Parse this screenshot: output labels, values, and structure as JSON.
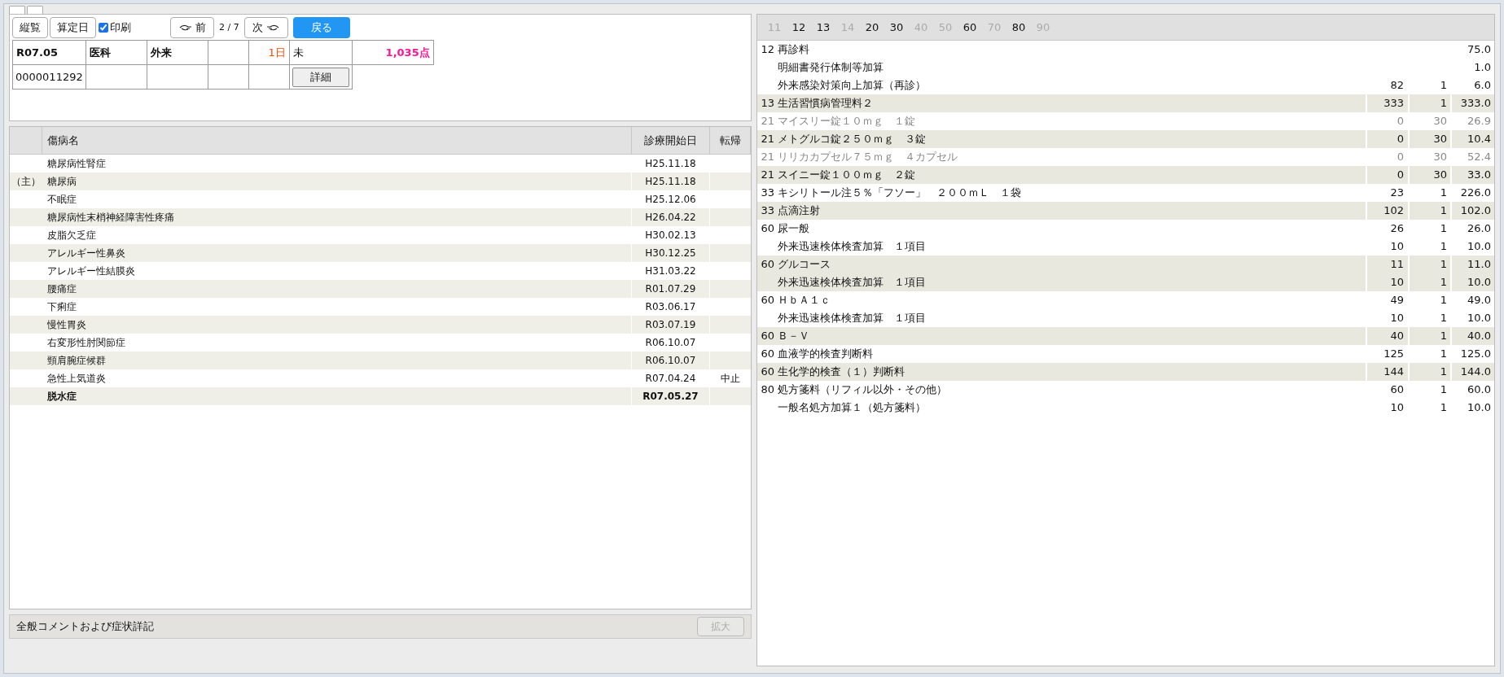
{
  "toolbar": {
    "buttons": [
      {
        "label": "縦覧"
      },
      {
        "label": "算定日"
      }
    ],
    "print_checkbox": {
      "label": "印刷",
      "checked": true
    },
    "prev_button": {
      "label": "前"
    },
    "page_indicator": "2 / 7",
    "next_button": {
      "label": "次"
    },
    "back_button": {
      "label": "戻る"
    }
  },
  "summary": {
    "row_1": {
      "column_1": "R07.05",
      "column_2": "医科",
      "column_3": "外来",
      "column_5": "1日",
      "column_6": "未",
      "column_7": "1,035点"
    },
    "row_2": {
      "column_1": "0000011292"
    },
    "detail_button": "詳細"
  },
  "disease_table": {
    "columns": [
      "",
      "傷病名",
      "診療開始日",
      "転帰"
    ],
    "rows": [
      {
        "prefix": "",
        "name": "糖尿病性腎症",
        "start": "H25.11.18",
        "outcome": "",
        "bold": false
      },
      {
        "prefix": "（主）",
        "name": "糖尿病",
        "start": "H25.11.18",
        "outcome": "",
        "bold": false
      },
      {
        "prefix": "",
        "name": "不眠症",
        "start": "H25.12.06",
        "outcome": "",
        "bold": false
      },
      {
        "prefix": "",
        "name": "糖尿病性末梢神経障害性疼痛",
        "start": "H26.04.22",
        "outcome": "",
        "bold": false
      },
      {
        "prefix": "",
        "name": "皮脂欠乏症",
        "start": "H30.02.13",
        "outcome": "",
        "bold": false
      },
      {
        "prefix": "",
        "name": "アレルギー性鼻炎",
        "start": "H30.12.25",
        "outcome": "",
        "bold": false
      },
      {
        "prefix": "",
        "name": "アレルギー性結膜炎",
        "start": "H31.03.22",
        "outcome": "",
        "bold": false
      },
      {
        "prefix": "",
        "name": "腰痛症",
        "start": "R01.07.29",
        "outcome": "",
        "bold": false
      },
      {
        "prefix": "",
        "name": "下痢症",
        "start": "R03.06.17",
        "outcome": "",
        "bold": false
      },
      {
        "prefix": "",
        "name": "慢性胃炎",
        "start": "R03.07.19",
        "outcome": "",
        "bold": false
      },
      {
        "prefix": "",
        "name": "右変形性肘関節症",
        "start": "R06.10.07",
        "outcome": "",
        "bold": false
      },
      {
        "prefix": "",
        "name": "頸肩腕症候群",
        "start": "R06.10.07",
        "outcome": "",
        "bold": false
      },
      {
        "prefix": "",
        "name": "急性上気道炎",
        "start": "R07.04.24",
        "outcome": "中止",
        "bold": false
      },
      {
        "prefix": "",
        "name": "脱水症",
        "start": "R07.05.27",
        "outcome": "",
        "bold": true
      }
    ]
  },
  "comment_bar": {
    "label": "全般コメントおよび症状詳記",
    "expand_button": {
      "label": "拡大",
      "disabled": true
    }
  },
  "category_tabs": [
    {
      "label": "11",
      "disabled": true
    },
    {
      "label": "12",
      "disabled": false
    },
    {
      "label": "13",
      "disabled": false
    },
    {
      "label": "14",
      "disabled": true
    },
    {
      "label": "20",
      "disabled": false
    },
    {
      "label": "30",
      "disabled": false
    },
    {
      "label": "40",
      "disabled": true
    },
    {
      "label": "50",
      "disabled": true
    },
    {
      "label": "60",
      "disabled": false
    },
    {
      "label": "70",
      "disabled": true
    },
    {
      "label": "80",
      "disabled": false
    },
    {
      "label": "90",
      "disabled": true
    }
  ],
  "billing_rows": [
    {
      "code": "12",
      "name": "再診料",
      "points": "",
      "count": "",
      "total": "75.0",
      "shaded": false,
      "dimmed": false
    },
    {
      "code": "",
      "name": "明細書発行体制等加算",
      "points": "",
      "count": "",
      "total": "1.0",
      "shaded": false,
      "dimmed": false
    },
    {
      "code": "",
      "name": "外来感染対策向上加算（再診）",
      "points": "82",
      "count": "1",
      "total": "6.0",
      "shaded": false,
      "dimmed": false
    },
    {
      "code": "13",
      "name": "生活習慣病管理料２",
      "points": "333",
      "count": "1",
      "total": "333.0",
      "shaded": true,
      "dimmed": false
    },
    {
      "code": "21",
      "name": "マイスリー錠１０ｍｇ　１錠",
      "points": "0",
      "count": "30",
      "total": "26.9",
      "shaded": false,
      "dimmed": true
    },
    {
      "code": "21",
      "name": "メトグルコ錠２５０ｍｇ　３錠",
      "points": "0",
      "count": "30",
      "total": "10.4",
      "shaded": true,
      "dimmed": false
    },
    {
      "code": "21",
      "name": "リリカカプセル７５ｍｇ　４カプセル",
      "points": "0",
      "count": "30",
      "total": "52.4",
      "shaded": false,
      "dimmed": true
    },
    {
      "code": "21",
      "name": "スイニー錠１００ｍｇ　２錠",
      "points": "0",
      "count": "30",
      "total": "33.0",
      "shaded": true,
      "dimmed": false
    },
    {
      "code": "33",
      "name": "キシリトール注５％「フソー」　２００ｍＬ　１袋",
      "points": "23",
      "count": "1",
      "total": "226.0",
      "shaded": false,
      "dimmed": false
    },
    {
      "code": "33",
      "name": "点滴注射",
      "points": "102",
      "count": "1",
      "total": "102.0",
      "shaded": true,
      "dimmed": false
    },
    {
      "code": "60",
      "name": "尿一般",
      "points": "26",
      "count": "1",
      "total": "26.0",
      "shaded": false,
      "dimmed": false
    },
    {
      "code": "",
      "name": "外来迅速検体検査加算　１項目",
      "points": "10",
      "count": "1",
      "total": "10.0",
      "shaded": false,
      "dimmed": false
    },
    {
      "code": "60",
      "name": "グルコース",
      "points": "11",
      "count": "1",
      "total": "11.0",
      "shaded": true,
      "dimmed": false
    },
    {
      "code": "",
      "name": "外来迅速検体検査加算　１項目",
      "points": "10",
      "count": "1",
      "total": "10.0",
      "shaded": true,
      "dimmed": false
    },
    {
      "code": "60",
      "name": "ＨｂＡ１ｃ",
      "points": "49",
      "count": "1",
      "total": "49.0",
      "shaded": false,
      "dimmed": false
    },
    {
      "code": "",
      "name": "外来迅速検体検査加算　１項目",
      "points": "10",
      "count": "1",
      "total": "10.0",
      "shaded": false,
      "dimmed": false
    },
    {
      "code": "60",
      "name": "Ｂ－Ｖ",
      "points": "40",
      "count": "1",
      "total": "40.0",
      "shaded": true,
      "dimmed": false
    },
    {
      "code": "60",
      "name": "血液学的検査判断料",
      "points": "125",
      "count": "1",
      "total": "125.0",
      "shaded": false,
      "dimmed": false
    },
    {
      "code": "60",
      "name": "生化学的検査（１）判断料",
      "points": "144",
      "count": "1",
      "total": "144.0",
      "shaded": true,
      "dimmed": false
    },
    {
      "code": "80",
      "name": "処方箋料（リフィル以外・その他）",
      "points": "60",
      "count": "1",
      "total": "60.0",
      "shaded": false,
      "dimmed": false
    },
    {
      "code": "",
      "name": "一般名処方加算１（処方箋料）",
      "points": "10",
      "count": "1",
      "total": "10.0",
      "shaded": false,
      "dimmed": false
    }
  ]
}
